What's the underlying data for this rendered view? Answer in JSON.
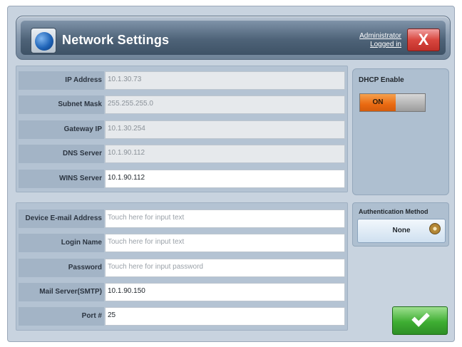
{
  "header": {
    "title": "Network Settings",
    "admin_line1": "Administrator",
    "admin_line2": "Logged in",
    "close_label": "X"
  },
  "network": [
    {
      "label": "IP Address",
      "value": "10.1.30.73"
    },
    {
      "label": "Subnet Mask",
      "value": "255.255.255.0"
    },
    {
      "label": "Gateway IP",
      "value": "10.1.30.254"
    },
    {
      "label": "DNS Server",
      "value": "10.1.90.112"
    },
    {
      "label": "WINS Server",
      "value": "10.1.90.112"
    }
  ],
  "dhcp": {
    "label": "DHCP Enable",
    "state": "ON"
  },
  "email": [
    {
      "label": "Device E-mail Address",
      "placeholder": "Touch here for input text"
    },
    {
      "label": "Login Name",
      "placeholder": "Touch here for input text"
    },
    {
      "label": "Password",
      "placeholder": "Touch here for input password"
    },
    {
      "label": "Mail Server(SMTP)",
      "value": "10.1.90.150"
    },
    {
      "label": "Port #",
      "value": "25"
    }
  ],
  "auth": {
    "label": "Authentication Method",
    "value": "None"
  },
  "colors": {
    "toggle_on": "#ea6a12",
    "ok_button": "#3fae33",
    "close_button": "#d9473f"
  }
}
